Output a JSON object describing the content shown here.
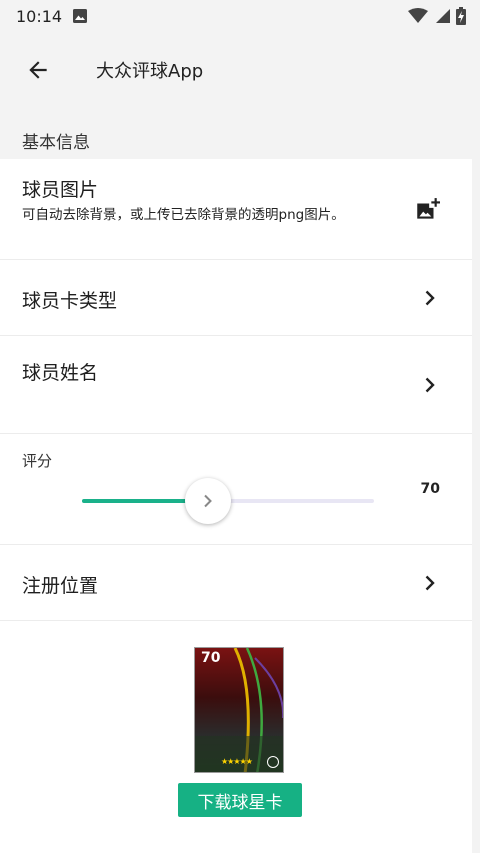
{
  "status_bar": {
    "time": "10:14",
    "icons": [
      "image-icon",
      "wifi-icon",
      "signal-icon",
      "battery-icon"
    ]
  },
  "app_bar": {
    "title": "大众评球App",
    "back_icon": "arrow-left-icon"
  },
  "section": {
    "label": "基本信息"
  },
  "player_image": {
    "title": "球员图片",
    "subtitle": "可自动去除背景，或上传已去除背景的透明png图片。",
    "icon": "add-photo-icon"
  },
  "card_type": {
    "title": "球员卡类型",
    "icon": "chevron-right-icon"
  },
  "player_name": {
    "title": "球员姓名",
    "icon": "chevron-right-icon"
  },
  "rating": {
    "label": "评分",
    "value": "70",
    "fraction": 0.43
  },
  "position": {
    "title": "注册位置",
    "icon": "chevron-right-icon"
  },
  "preview_card": {
    "rating": "70",
    "stars": "★★★★★"
  },
  "download_button": {
    "label": "下载球星卡"
  },
  "colors": {
    "accent": "#16b184",
    "slider_track": "#e8e6f4",
    "background": "#f3f3f3"
  }
}
